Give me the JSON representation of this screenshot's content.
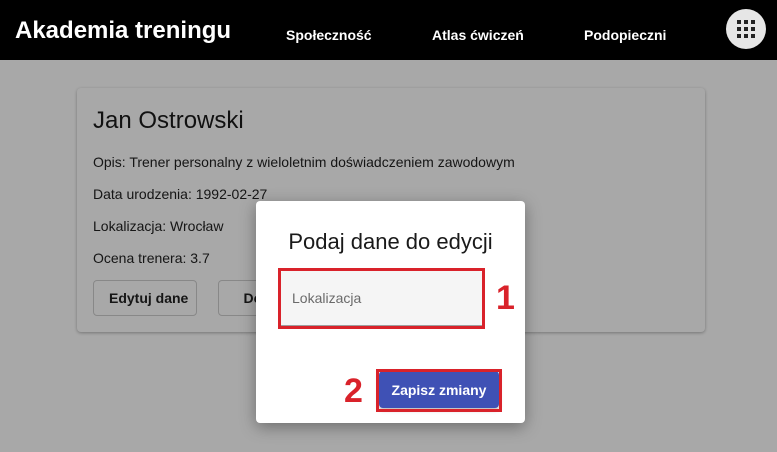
{
  "nav": {
    "brand": "Akademia treningu",
    "links": [
      "Społeczność",
      "Atlas ćwiczeń",
      "Podopieczni"
    ],
    "apps_icon": "grid-apps-icon"
  },
  "profile": {
    "name": "Jan Ostrowski",
    "description": "Opis: Trener personalny z wieloletnim doświadczeniem zawodowym",
    "birthdate": "Data urodzenia: 1992-02-27",
    "location": "Lokalizacja: Wrocław",
    "rating": "Ocena trenera: 3.7",
    "edit_button": "Edytuj dane",
    "second_button": "Dodaj"
  },
  "dialog": {
    "title": "Podaj dane do edycji",
    "location_placeholder": "Lokalizacja",
    "location_value": "",
    "save_button": "Zapisz zmiany"
  },
  "annotations": {
    "marker_1": "1",
    "marker_2": "2",
    "highlight_color": "#d9222a"
  },
  "colors": {
    "navbar_bg": "#000000",
    "primary_button": "#3f51b5"
  }
}
